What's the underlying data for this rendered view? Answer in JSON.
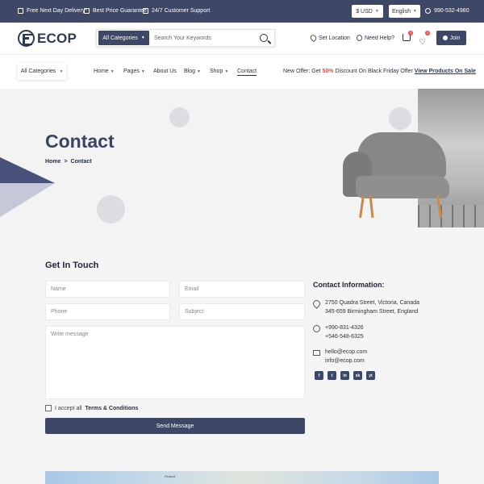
{
  "topbar": {
    "features": [
      "Free Next Day Delivery*",
      "Best Price Guarantee",
      "24/7 Customer Support"
    ],
    "currency": "$ USD",
    "language": "English",
    "phone": "990-532-4980"
  },
  "header": {
    "logo": "ECOP",
    "category_select": "All Categories",
    "search_placeholder": "Search Your Keywords",
    "set_location": "Set Location",
    "need_help": "Need Help?",
    "cart_count": "0",
    "wishlist_count": "0",
    "join": "Join"
  },
  "nav": {
    "all_categories": "All Categories",
    "items": [
      {
        "label": "Home"
      },
      {
        "label": "Pages"
      },
      {
        "label": "About Us"
      },
      {
        "label": "Blog"
      },
      {
        "label": "Shop"
      },
      {
        "label": "Contact"
      }
    ],
    "offer_prefix": "New Offer: Get",
    "offer_pct": "50%",
    "offer_mid": "Discount On Black Friday Offer",
    "offer_link": "View Products On Sale"
  },
  "hero": {
    "title": "Contact",
    "breadcrumb": [
      "Home",
      ">",
      "Contact"
    ]
  },
  "contact_form": {
    "heading": "Get In Touch",
    "name_placeholder": "Name",
    "email_placeholder": "Email",
    "phone_placeholder": "Phone",
    "subject_placeholder": "Subject",
    "message_placeholder": "Write message",
    "accept_prefix": "I accept all",
    "accept_link": "Terms & Conditions",
    "send": "Send Message"
  },
  "contact_info": {
    "heading": "Contact Information:",
    "address": [
      "2750 Quadra Street, Victoria, Canada",
      "345-659 Birmingham Street, England"
    ],
    "phones": [
      "+990-831-4326",
      "+546-548-6325"
    ],
    "emails": [
      "hello@ecop.com",
      "info@ecop.com"
    ],
    "socials": [
      "f",
      "t",
      "in",
      "sk",
      "yt"
    ]
  },
  "map": {
    "label": "Finland"
  },
  "colors": {
    "primary": "#3d4766",
    "accent": "#e84b4b"
  }
}
